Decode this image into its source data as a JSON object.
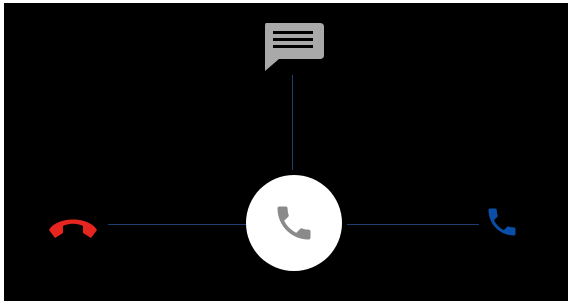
{
  "screen": {
    "background": "#000000",
    "track_color": "#1f3f73"
  },
  "targets": {
    "message": {
      "icon": "message-icon",
      "color": "#a9a9a9"
    },
    "decline": {
      "icon": "decline-call-icon",
      "color": "#e5261f"
    },
    "answer": {
      "icon": "answer-call-icon",
      "color": "#0a4ea8"
    }
  },
  "handle": {
    "icon": "phone-icon",
    "background": "#ffffff",
    "icon_color": "#8a8a8a"
  }
}
